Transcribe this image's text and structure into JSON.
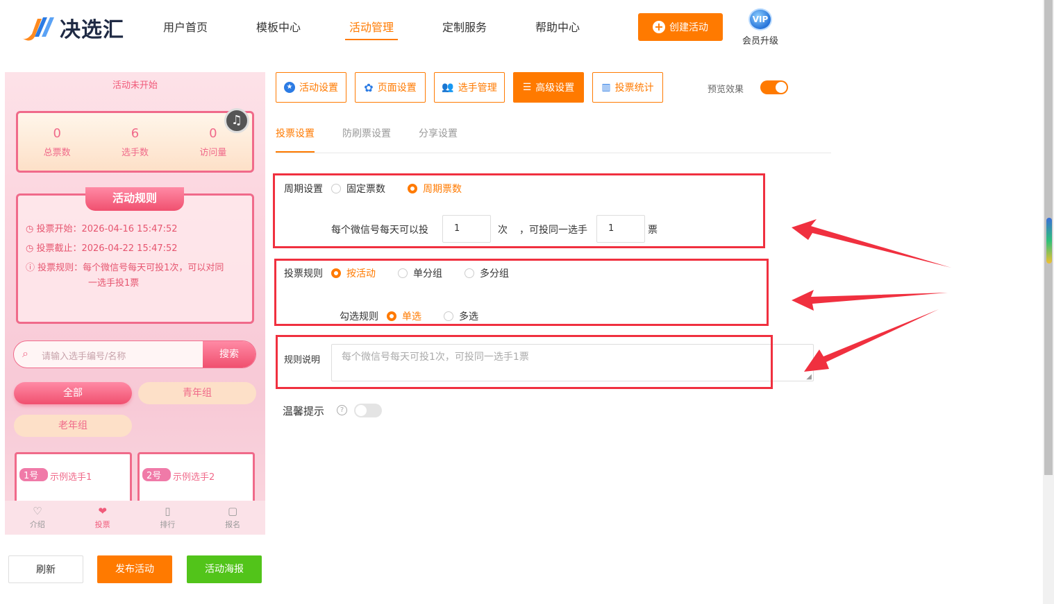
{
  "header": {
    "logo_text": "决选汇",
    "nav": [
      "用户首页",
      "模板中心",
      "活动管理",
      "定制服务",
      "帮助中心"
    ],
    "create_btn": "创建活动",
    "vip_badge": "VIP",
    "vip_label": "会员升级"
  },
  "phone": {
    "status": "活动未开始",
    "stats": [
      {
        "value": "0",
        "label": "总票数"
      },
      {
        "value": "6",
        "label": "选手数"
      },
      {
        "value": "0",
        "label": "访问量"
      }
    ],
    "rules_title": "活动规则",
    "rule_start": "投票开始：2026-04-16 15:47:52",
    "rule_end": "投票截止：2026-04-22 15:47:52",
    "rule_text_1": "投票规则：每个微信号每天可投1次，可以对同",
    "rule_text_2": "一选手投1票",
    "search_placeholder": "请输入选手编号/名称",
    "search_btn": "搜索",
    "groups": [
      "全部",
      "青年组",
      "老年组"
    ],
    "players": [
      {
        "tag": "1号",
        "name": "示例选手1"
      },
      {
        "tag": "2号",
        "name": "示例选手2"
      }
    ],
    "bottom_nav": [
      "介绍",
      "投票",
      "排行",
      "报名"
    ]
  },
  "bottom_buttons": {
    "refresh": "刷新",
    "publish": "发布活动",
    "poster": "活动海报"
  },
  "toolbar": {
    "buttons": [
      "活动设置",
      "页面设置",
      "选手管理",
      "高级设置",
      "投票统计"
    ],
    "preview_label": "预览效果"
  },
  "sub_tabs": [
    "投票设置",
    "防刷票设置",
    "分享设置"
  ],
  "form": {
    "period_label": "周期设置",
    "period_options": [
      "固定票数",
      "周期票数"
    ],
    "per_day_text": "每个微信号每天可以投",
    "times_value": "1",
    "times_unit": "次",
    "same_player_text": "，可投同一选手",
    "votes_value": "1",
    "votes_unit": "票",
    "rule_label": "投票规则",
    "rule_options": [
      "按活动",
      "单分组",
      "多分组"
    ],
    "check_label": "勾选规则",
    "check_options": [
      "单选",
      "多选"
    ],
    "desc_label": "规则说明",
    "desc_placeholder": "每个微信号每天可投1次，可投同一选手1票",
    "tips_label": "温馨提示"
  },
  "colors": {
    "accent": "#ff7a00",
    "highlight_box": "#f0303f",
    "green": "#52c41a"
  }
}
